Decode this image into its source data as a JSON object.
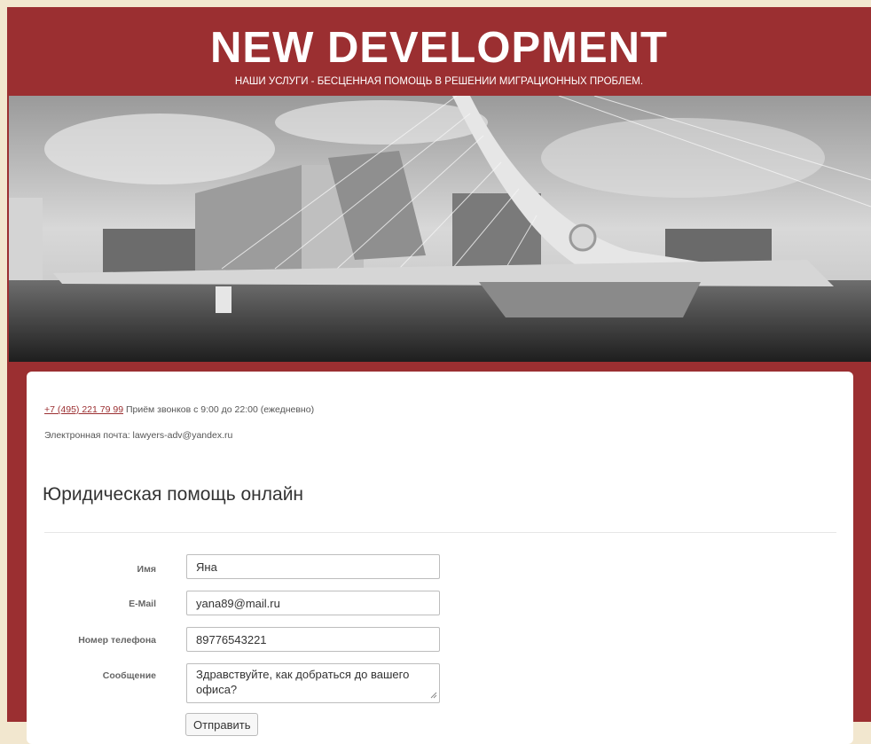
{
  "header": {
    "title": "NEW DEVELOPMENT",
    "tagline": "НАШИ УСЛУГИ - БЕСЦЕННАЯ ПОМОЩЬ В РЕШЕНИИ МИГРАЦИОННЫХ ПРОБЛЕМ."
  },
  "hero": {
    "image_subject": "black-and-white photo of cable-stayed bridge and modern buildings"
  },
  "contact": {
    "phone": "+7 (495) 221 79 99",
    "hours": " Приём звонков с 9:00 до 22:00 (ежедневно)",
    "email_line": "Электронная почта: lawyers-adv@yandex.ru"
  },
  "main": {
    "heading": "Юридическая помощь онлайн"
  },
  "form": {
    "name_label": "Имя",
    "name_value": "Яна",
    "email_label": "E-Mail",
    "email_value": "yana89@mail.ru",
    "phone_label": "Номер телефона",
    "phone_value": "89776543221",
    "message_label": "Сообщение",
    "message_value": "Здравствуйте, как добраться до вашего офиса?",
    "submit_label": "Отправить"
  },
  "colors": {
    "brand": "#9b2f31",
    "page_bg": "#f2e7cf",
    "panel_bg": "#ffffff"
  }
}
